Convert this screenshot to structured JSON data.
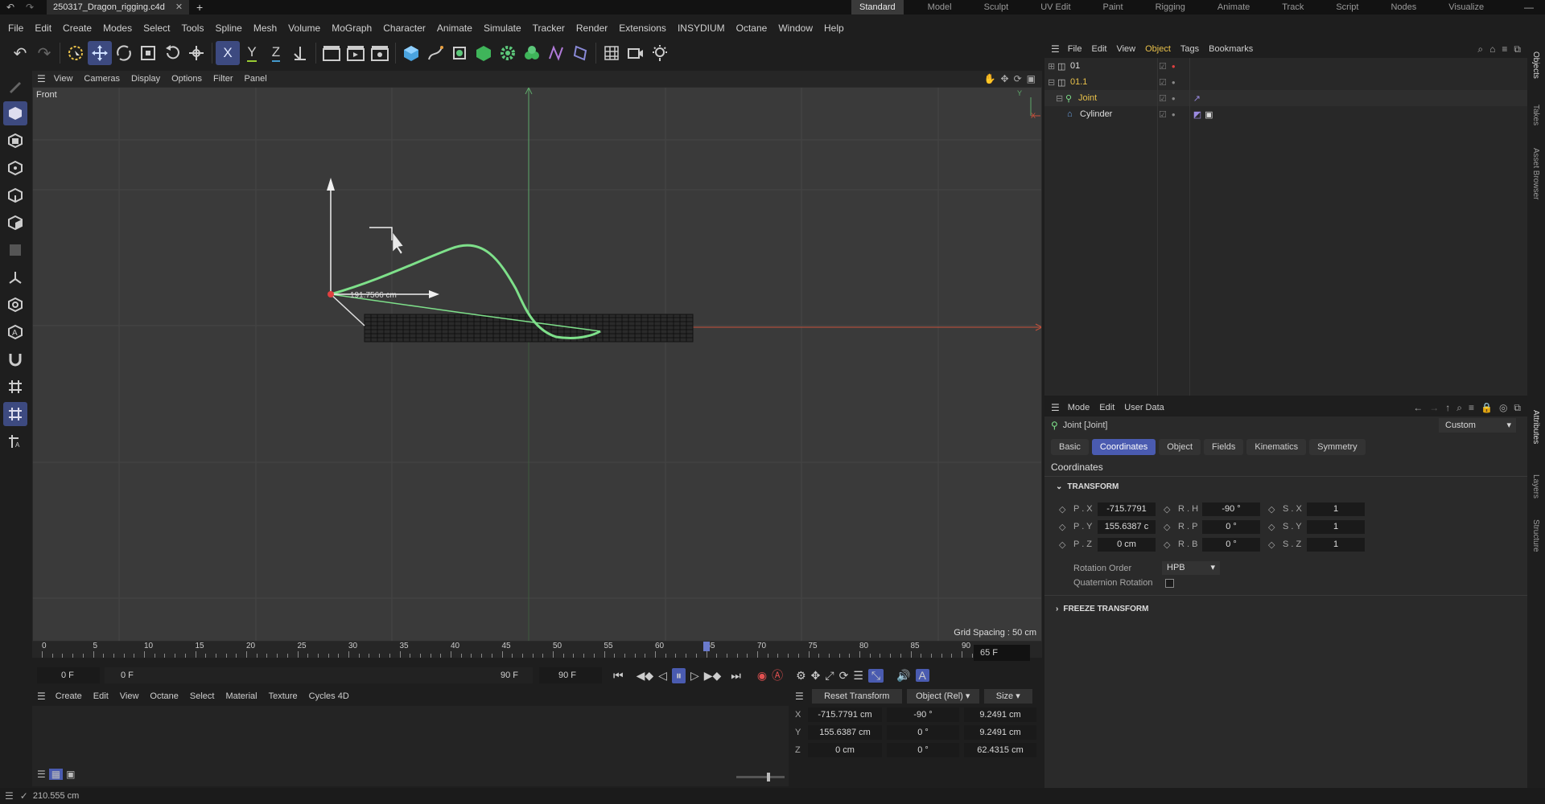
{
  "window": {
    "file_tab": "250317_Dragon_rigging.c4d",
    "layouts": [
      "Standard",
      "Model",
      "Sculpt",
      "UV Edit",
      "Paint",
      "Rigging",
      "Animate",
      "Track",
      "Script",
      "Nodes",
      "Visualize"
    ],
    "active_layout": "Standard"
  },
  "menu": [
    "File",
    "Edit",
    "Create",
    "Modes",
    "Select",
    "Tools",
    "Spline",
    "Mesh",
    "Volume",
    "MoGraph",
    "Character",
    "Animate",
    "Simulate",
    "Tracker",
    "Render",
    "Extensions",
    "INSYDIUM",
    "Octane",
    "Window",
    "Help"
  ],
  "toolbar": {
    "x_label": "X",
    "y_label": "Y",
    "z_label": "Z"
  },
  "viewport": {
    "menu": [
      "View",
      "Cameras",
      "Display",
      "Options",
      "Filter",
      "Panel"
    ],
    "view_name": "Front",
    "measure_label": "191.7566 cm",
    "grid_spacing": "Grid Spacing : 50 cm",
    "axis_y": "Y",
    "axis_x": "X"
  },
  "timeline": {
    "ticks": [
      "0",
      "5",
      "10",
      "15",
      "20",
      "25",
      "30",
      "35",
      "40",
      "45",
      "50",
      "55",
      "60",
      "65",
      "70",
      "75",
      "80",
      "85",
      "90"
    ],
    "current_frame": "65 F",
    "current_value": 65,
    "start": "0 F",
    "range_start": "0 F",
    "range_end": "90 F",
    "end": "90 F"
  },
  "material_menu": [
    "Create",
    "Edit",
    "View",
    "Octane",
    "Select",
    "Material",
    "Texture",
    "Cycles 4D"
  ],
  "coords": {
    "reset_label": "Reset Transform",
    "space": "Object (Rel)",
    "mode": "Size",
    "rows": [
      {
        "axis": "X",
        "pos": "-715.7791 cm",
        "rot": "-90 °",
        "size": "9.2491 cm"
      },
      {
        "axis": "Y",
        "pos": "155.6387 cm",
        "rot": "0 °",
        "size": "9.2491 cm"
      },
      {
        "axis": "Z",
        "pos": "0 cm",
        "rot": "0 °",
        "size": "62.4315 cm"
      }
    ]
  },
  "status": {
    "text": "210.555 cm"
  },
  "objects": {
    "menu": [
      "File",
      "Edit",
      "View",
      "Object",
      "Tags",
      "Bookmarks"
    ],
    "items": [
      {
        "name": "01",
        "level": 0
      },
      {
        "name": "01.1",
        "level": 0
      },
      {
        "name": "Joint",
        "level": 1
      },
      {
        "name": "Cylinder",
        "level": 2
      }
    ]
  },
  "attributes": {
    "menu": [
      "Mode",
      "Edit",
      "User Data"
    ],
    "title": "Joint [Joint]",
    "preset": "Custom",
    "tabs": [
      "Basic",
      "Coordinates",
      "Object",
      "Fields",
      "Kinematics",
      "Symmetry"
    ],
    "active_tab": "Coordinates",
    "section": "Coordinates",
    "group": "TRANSFORM",
    "fields": [
      {
        "p_label": "P . X",
        "p_val": "-715.7791",
        "r_label": "R . H",
        "r_val": "-90 °",
        "s_label": "S . X",
        "s_val": "1"
      },
      {
        "p_label": "P . Y",
        "p_val": "155.6387 c",
        "r_label": "R . P",
        "r_val": "0 °",
        "s_label": "S . Y",
        "s_val": "1"
      },
      {
        "p_label": "P . Z",
        "p_val": "0 cm",
        "r_label": "R . B",
        "r_val": "0 °",
        "s_label": "S . Z",
        "s_val": "1"
      }
    ],
    "rotation_order_label": "Rotation Order",
    "rotation_order": "HPB",
    "quaternion_label": "Quaternion Rotation",
    "freeze_label": "FREEZE TRANSFORM"
  },
  "side_tabs": [
    "Objects",
    "Takes",
    "Asset Browser",
    "Attributes",
    "Layers",
    "Structure"
  ],
  "colors": {
    "accent": "#4a5bb0",
    "active_object": "#e8c04a",
    "spline": "#7ee08a",
    "x_axis": "#c8523c"
  }
}
